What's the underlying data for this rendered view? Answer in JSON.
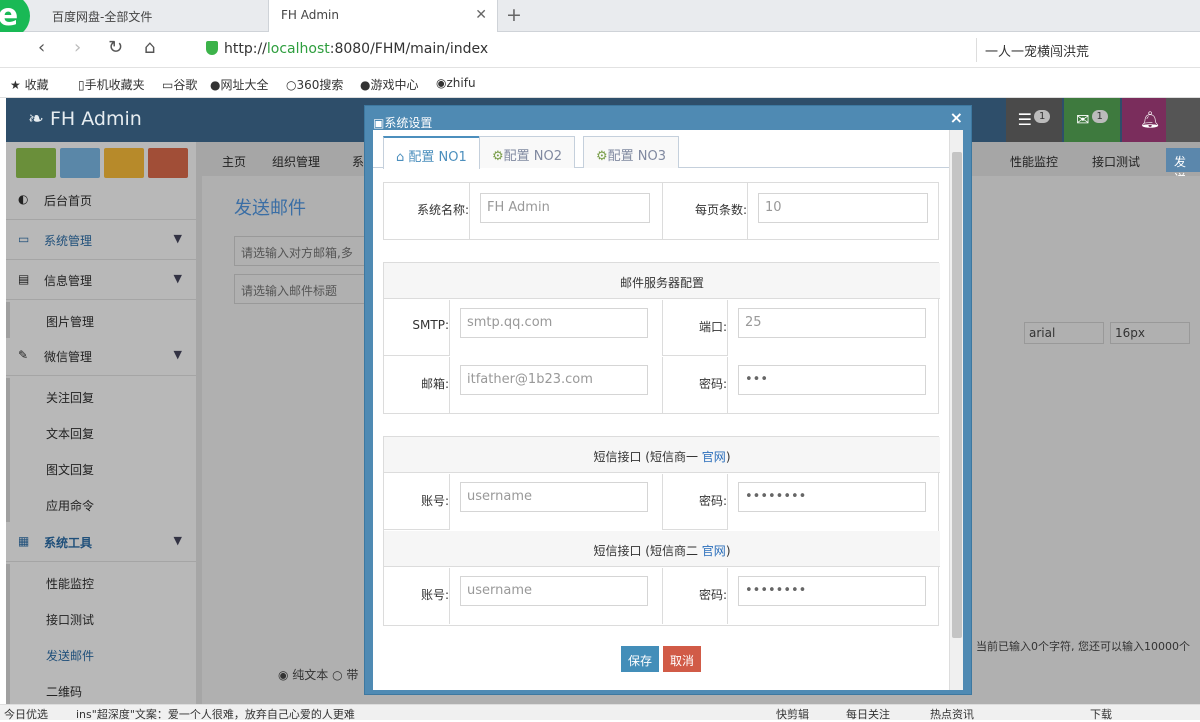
{
  "browser": {
    "tabs": [
      {
        "label": "百度网盘-全部文件"
      },
      {
        "label": "FH Admin"
      }
    ],
    "url_prefix": "http://",
    "url_host": "localhost",
    "url_rest": ":8080/FHM/main/index",
    "search_text": "一人一宠横闯洪荒",
    "bookmarks": [
      "收藏",
      "手机收藏夹",
      "谷歌",
      "网址大全",
      "360搜索",
      "游戏中心",
      "zhifu"
    ]
  },
  "app": {
    "brand": "FH Admin",
    "header_badges": [
      "1",
      "1"
    ],
    "sidebar": {
      "items": [
        {
          "label": "后台首页"
        },
        {
          "label": "系统管理"
        },
        {
          "label": "信息管理"
        },
        {
          "label": "图片管理"
        },
        {
          "label": "微信管理"
        },
        {
          "label": "关注回复"
        },
        {
          "label": "文本回复"
        },
        {
          "label": "图文回复"
        },
        {
          "label": "应用命令"
        },
        {
          "label": "系统工具"
        },
        {
          "label": "性能监控"
        },
        {
          "label": "接口测试"
        },
        {
          "label": "发送邮件"
        },
        {
          "label": "二维码"
        }
      ]
    },
    "top_tabs": [
      "主页",
      "组织管理",
      "系",
      "性能监控",
      "接口测试",
      "发送"
    ],
    "page_title": "发送邮件",
    "email_placeholder": "请选输入对方邮箱,多",
    "subject_placeholder": "请选输入邮件标题",
    "editor_font": "arial",
    "editor_size": "16px",
    "char_counter": "当前已输入0个字符, 您还可以输入10000个",
    "radio_label_1": "纯文本",
    "radio_label_2": "带"
  },
  "modal": {
    "title": "系统设置",
    "close": "×",
    "tabs": [
      {
        "label": "配置 NO1"
      },
      {
        "label": "配置 NO2"
      },
      {
        "label": "配置 NO3"
      }
    ],
    "system_name_label": "系统名称:",
    "system_name_value": "FH Admin",
    "page_size_label": "每页条数:",
    "page_size_value": "10",
    "mail_section": "邮件服务器配置",
    "smtp_label": "SMTP:",
    "smtp_value": "smtp.qq.com",
    "port_label": "端口:",
    "port_value": "25",
    "email_label": "邮箱:",
    "email_value": "itfather@1b23.com",
    "password_label": "密码:",
    "email_password": "•••",
    "sms1_section": "短信接口 (短信商一 ",
    "sms1_link": "官网",
    "sms_close_paren": ")",
    "sms2_section": "短信接口 (短信商二 ",
    "sms2_link": "官网",
    "account_label": "账号:",
    "account_placeholder": "username",
    "sms_password": "••••••••",
    "save": "保存",
    "cancel": "取消"
  },
  "statusbar": {
    "left": "今日优选",
    "news": "ins\"超深度\"文案：爱一个人很难，放弃自己心爱的人更难",
    "items": [
      "快剪辑",
      "每日关注",
      "热点资讯",
      "下载"
    ]
  }
}
